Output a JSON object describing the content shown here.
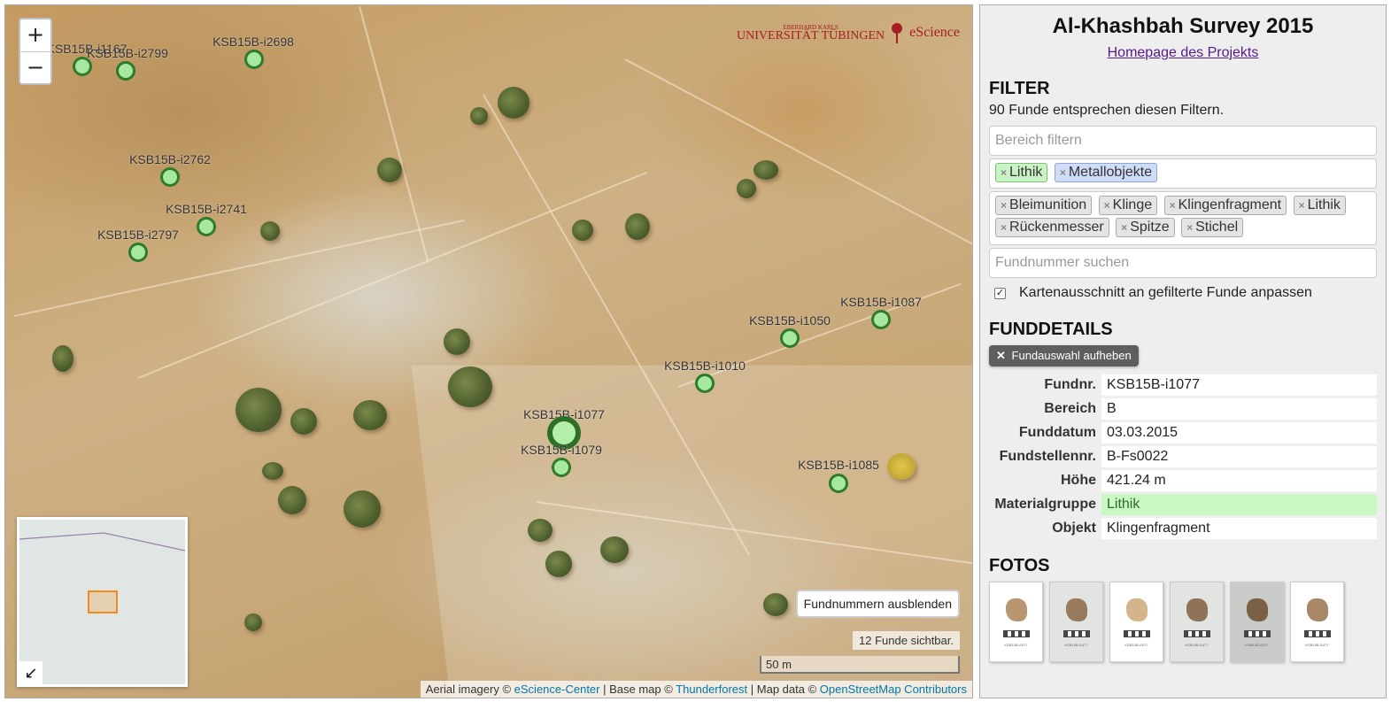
{
  "map": {
    "zoom_in": "+",
    "zoom_out": "−",
    "logo_uni_top": "EBERHARD KARLS",
    "logo_uni_main": "UNIVERSITÄT TÜBINGEN",
    "logo_escience": "eScience",
    "minimap_toggle": "↙",
    "toggle_numbers": "Fundnummern ausblenden",
    "visible_count": "12 Funde sichtbar.",
    "scale_label": "50 m",
    "attribution": {
      "aerial_prefix": "Aerial imagery ©",
      "aerial_link": "eScience-Center",
      "base_prefix": "| Base map ©",
      "base_link": "Thunderforest",
      "data_prefix": "| Map data ©",
      "data_link": "OpenStreetMap Contributors"
    },
    "markers": [
      {
        "label": "KSB15B-i1167",
        "selected": false
      },
      {
        "label": "KSB15B-i2799",
        "selected": false
      },
      {
        "label": "KSB15B-i2698",
        "selected": false
      },
      {
        "label": "KSB15B-i2762",
        "selected": false
      },
      {
        "label": "KSB15B-i2741",
        "selected": false
      },
      {
        "label": "KSB15B-i2797",
        "selected": false
      },
      {
        "label": "KSB15B-i1087",
        "selected": false
      },
      {
        "label": "KSB15B-i1050",
        "selected": false
      },
      {
        "label": "KSB15B-i1010",
        "selected": false
      },
      {
        "label": "KSB15B-i1077",
        "selected": true
      },
      {
        "label": "KSB15B-i1079",
        "selected": false
      },
      {
        "label": "KSB15B-i1085",
        "selected": false
      }
    ]
  },
  "panel": {
    "title": "Al-Khashbah Survey 2015",
    "homepage_link": "Homepage des Projekts",
    "filter": {
      "heading": "FILTER",
      "count_text": "90 Funde entsprechen diesen Filtern.",
      "area_placeholder": "Bereich filtern",
      "material_tags": [
        {
          "label": "Lithik",
          "color": "#c9f2c5"
        },
        {
          "label": "Metallobjekte",
          "color": "#cfdcf7"
        }
      ],
      "object_tags": [
        "Bleimunition",
        "Klinge",
        "Klingenfragment",
        "Lithik",
        "Rückenmesser",
        "Spitze",
        "Stichel"
      ],
      "search_placeholder": "Fundnummer suchen",
      "fit_checkbox_label": "Kartenausschnitt an gefilterte Funde anpassen",
      "fit_checkbox_checked": true
    },
    "details": {
      "heading": "FUNDDETAILS",
      "clear_button": "Fundauswahl aufheben",
      "rows": [
        {
          "key": "Fundnr.",
          "value": "KSB15B-i1077"
        },
        {
          "key": "Bereich",
          "value": "B"
        },
        {
          "key": "Funddatum",
          "value": "03.03.2015"
        },
        {
          "key": "Fundstellennr.",
          "value": "B-Fs0022"
        },
        {
          "key": "Höhe",
          "value": "421.24 m"
        },
        {
          "key": "Materialgruppe",
          "value": "Lithik"
        },
        {
          "key": "Objekt",
          "value": "Klingenfragment"
        }
      ]
    },
    "photos": {
      "heading": "FOTOS",
      "caption": "KSB15B-i1077"
    }
  }
}
